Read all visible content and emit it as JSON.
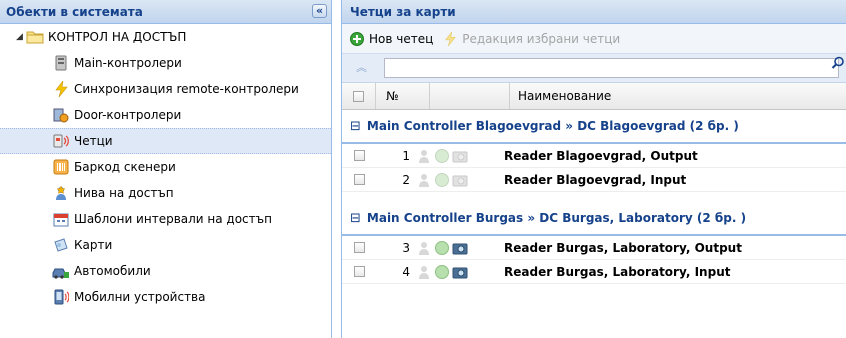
{
  "left_panel": {
    "title": "Обекти в системата",
    "collapse_glyph": "«",
    "tree": [
      {
        "label": "КОНТРОЛ НА ДОСТЪП",
        "icon": "folder-icon",
        "level": 0,
        "expanded": true
      },
      {
        "label": "Main-контролери",
        "icon": "server-icon",
        "level": 1
      },
      {
        "label": "Синхронизация remote-контролери",
        "icon": "lightning-icon",
        "level": 1
      },
      {
        "label": "Door-контролери",
        "icon": "door-controller-icon",
        "level": 1
      },
      {
        "label": "Четци",
        "icon": "card-reader-icon",
        "level": 1,
        "selected": true
      },
      {
        "label": "Баркод скенери",
        "icon": "barcode-scanner-icon",
        "level": 1
      },
      {
        "label": "Нива на достъп",
        "icon": "star-person-icon",
        "level": 1
      },
      {
        "label": "Шаблони интервали на достъп",
        "icon": "calendar-icon",
        "level": 1
      },
      {
        "label": "Карти",
        "icon": "card-icon",
        "level": 1
      },
      {
        "label": "Автомобили",
        "icon": "car-icon",
        "level": 1
      },
      {
        "label": "Мобилни устройства",
        "icon": "mobile-device-icon",
        "level": 1
      }
    ]
  },
  "right_panel": {
    "title": "Четци за карти",
    "toolbar": {
      "new_label": "Нов четец",
      "edit_label": "Редакция избрани четци"
    },
    "search": {
      "value": "",
      "placeholder": ""
    },
    "columns": {
      "no": "№",
      "name": "Наименование"
    },
    "groups": [
      {
        "title": "Main Controller Blagoevgrad » DC Blagoevgrad (2 бр. )",
        "rows": [
          {
            "no": "1",
            "name": "Reader Blagoevgrad, Output",
            "active": false
          },
          {
            "no": "2",
            "name": "Reader Blagoevgrad, Input",
            "active": false
          }
        ]
      },
      {
        "title": "Main Controller Burgas » DC Burgas, Laboratory (2 бр. )",
        "rows": [
          {
            "no": "3",
            "name": "Reader Burgas, Laboratory, Output",
            "active": true
          },
          {
            "no": "4",
            "name": "Reader Burgas, Laboratory, Input",
            "active": true
          }
        ]
      }
    ]
  },
  "colors": {
    "header_text": "#15428b",
    "header_bg": "#c1d5ee",
    "selected_bg": "#dfe8f6",
    "add_green": "#3aa53a",
    "disabled_lightning": "#f3d87a"
  }
}
